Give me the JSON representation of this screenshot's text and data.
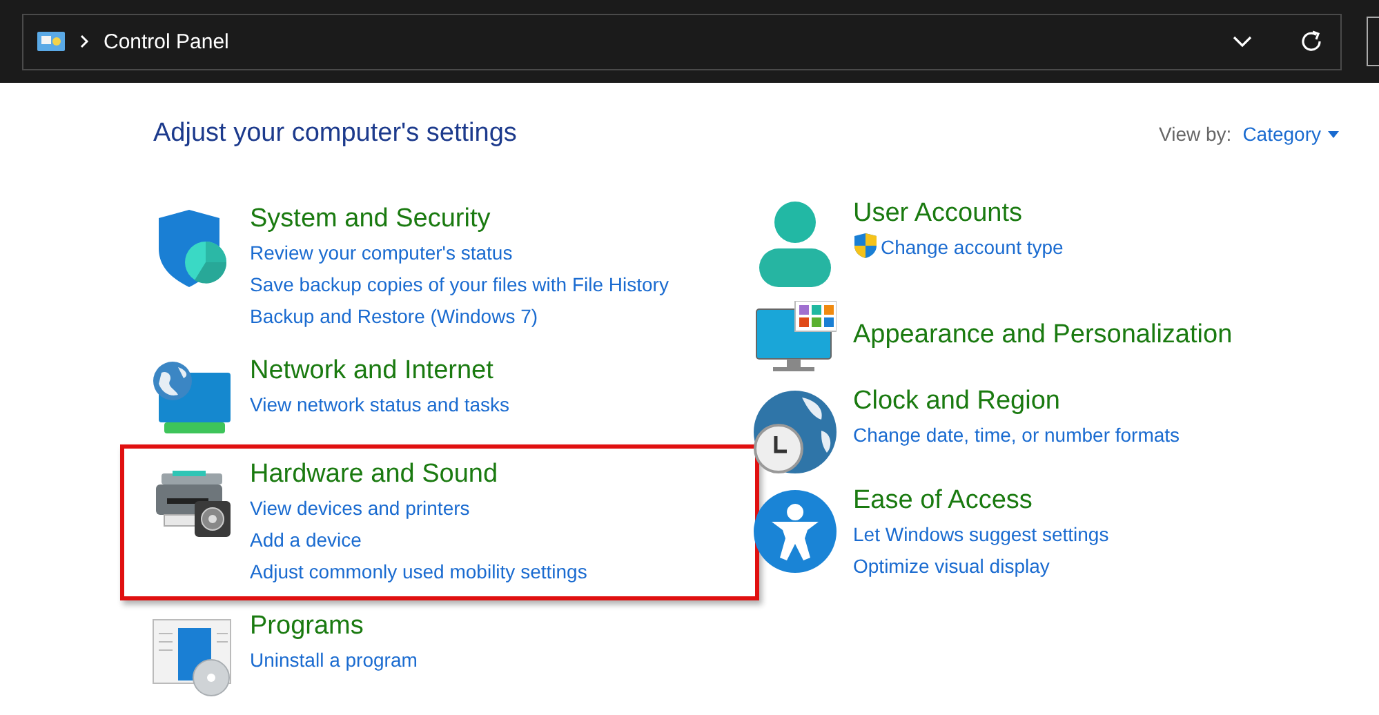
{
  "address_bar": {
    "path": "Control Panel"
  },
  "heading": "Adjust your computer's settings",
  "view_by": {
    "label": "View by:",
    "value": "Category"
  },
  "columns": [
    [
      {
        "kind": "system",
        "title": "System and Security",
        "highlighted": false,
        "links": [
          {
            "text": "Review your computer's status",
            "shield": false
          },
          {
            "text": "Save backup copies of your files with File History",
            "shield": false
          },
          {
            "text": "Backup and Restore (Windows 7)",
            "shield": false
          }
        ]
      },
      {
        "kind": "network",
        "title": "Network and Internet",
        "highlighted": false,
        "links": [
          {
            "text": "View network status and tasks",
            "shield": false
          }
        ]
      },
      {
        "kind": "hardware",
        "title": "Hardware and Sound",
        "highlighted": true,
        "links": [
          {
            "text": "View devices and printers",
            "shield": false
          },
          {
            "text": "Add a device",
            "shield": false
          },
          {
            "text": "Adjust commonly used mobility settings",
            "shield": false
          }
        ]
      },
      {
        "kind": "programs",
        "title": "Programs",
        "highlighted": false,
        "links": [
          {
            "text": "Uninstall a program",
            "shield": false
          }
        ]
      }
    ],
    [
      {
        "kind": "user",
        "title": "User Accounts",
        "highlighted": false,
        "links": [
          {
            "text": "Change account type",
            "shield": true
          }
        ]
      },
      {
        "kind": "appearance",
        "title": "Appearance and Personalization",
        "highlighted": false
      },
      {
        "kind": "clock",
        "title": "Clock and Region",
        "highlighted": false,
        "links": [
          {
            "text": "Change date, time, or number formats",
            "shield": false
          }
        ]
      },
      {
        "kind": "ease",
        "title": "Ease of Access",
        "highlighted": false,
        "links": [
          {
            "text": "Let Windows suggest settings",
            "shield": false
          },
          {
            "text": "Optimize visual display",
            "shield": false
          }
        ]
      }
    ]
  ]
}
